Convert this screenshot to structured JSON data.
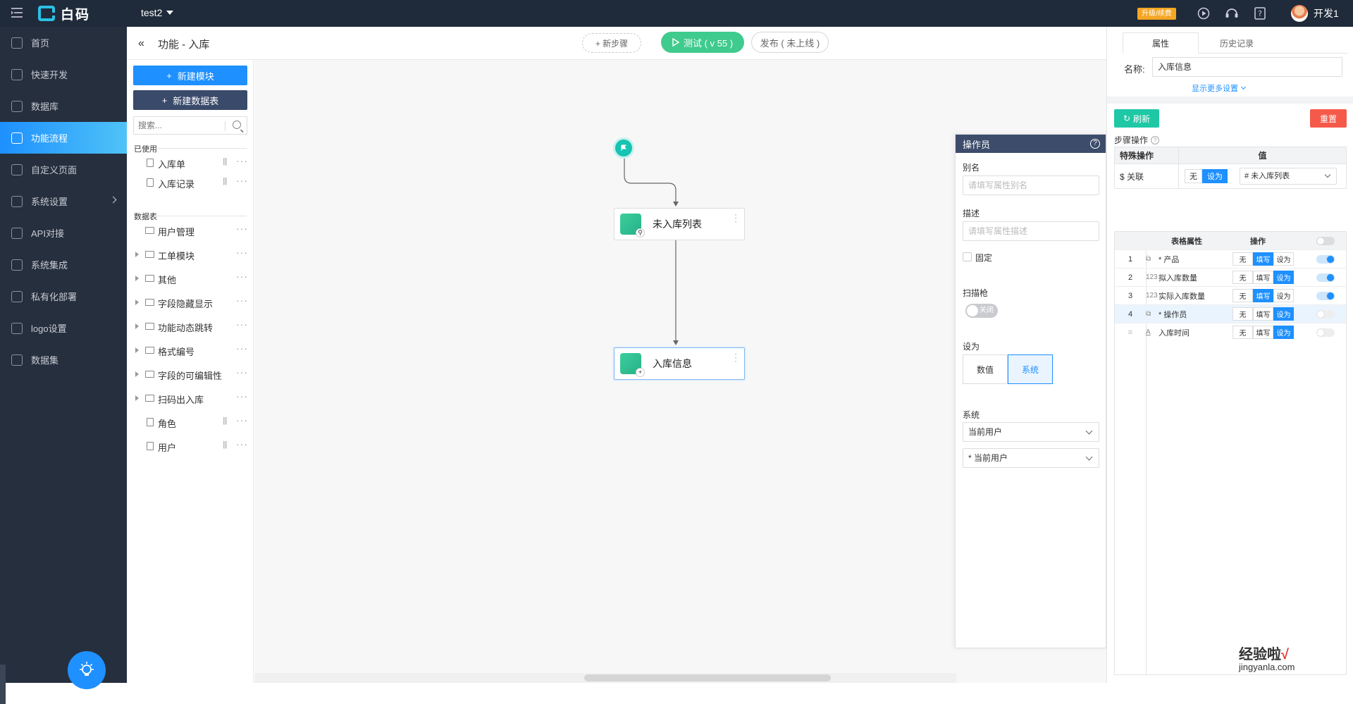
{
  "topbar": {
    "logo_text": "白码",
    "project": "test2",
    "upgrade_label": "升级/续费",
    "user_name": "开发1",
    "icons": [
      "menu-icon",
      "play-circle-icon",
      "support-icon",
      "help-icon"
    ]
  },
  "sidebar": {
    "items": [
      {
        "label": "首页",
        "icon": "home-icon"
      },
      {
        "label": "快速开发",
        "icon": "cube-icon"
      },
      {
        "label": "数据库",
        "icon": "database-icon"
      },
      {
        "label": "功能流程",
        "icon": "flow-icon",
        "active": true
      },
      {
        "label": "自定义页面",
        "icon": "page-icon"
      },
      {
        "label": "系统设置",
        "icon": "settings-icon"
      },
      {
        "label": "API对接",
        "icon": "api-icon"
      },
      {
        "label": "系统集成",
        "icon": "layers-icon"
      },
      {
        "label": "私有化部署",
        "icon": "server-icon"
      },
      {
        "label": "logo设置",
        "icon": "logo-icon"
      },
      {
        "label": "数据集",
        "icon": "dataset-icon"
      }
    ]
  },
  "header": {
    "title": "功能 - 入库",
    "add_step": "+ 新步骤",
    "test_button": "测试 ( v 55 )",
    "publish_button": "发布 ( 未上线 )"
  },
  "tree": {
    "new_module": "新建模块",
    "new_table": "新建数据表",
    "search_placeholder": "搜索...",
    "used_label": "已使用",
    "used_items": [
      "入库单",
      "入库记录"
    ],
    "tables_label": "数据表",
    "table_items": [
      {
        "label": "用户管理",
        "type": "folder",
        "expand": false
      },
      {
        "label": "工单模块",
        "type": "folder",
        "expand": true
      },
      {
        "label": "其他",
        "type": "folder",
        "expand": true
      },
      {
        "label": "字段隐藏显示",
        "type": "folder",
        "expand": true
      },
      {
        "label": "功能动态跳转",
        "type": "folder",
        "expand": true
      },
      {
        "label": "格式编号",
        "type": "folder",
        "expand": true
      },
      {
        "label": "字段的可编辑性",
        "type": "folder",
        "expand": true
      },
      {
        "label": "扫码出入库",
        "type": "folder",
        "expand": true
      },
      {
        "label": "角色",
        "type": "doc",
        "expand": false
      },
      {
        "label": "用户",
        "type": "doc",
        "expand": false
      }
    ]
  },
  "canvas": {
    "node1": "未入库列表",
    "node2": "入库信息"
  },
  "operator_panel": {
    "title": "操作员",
    "alias_label": "别名",
    "alias_placeholder": "请填写属性别名",
    "desc_label": "描述",
    "desc_placeholder": "请填写属性描述",
    "fixed_label": "固定",
    "scanner_label": "扫描枪",
    "scanner_toggle": "关闭",
    "set_label": "设为",
    "seg_value": "数值",
    "seg_system": "系统",
    "system_label": "系统",
    "system_select": "当前用户",
    "system_select2": "* 当前用户"
  },
  "right": {
    "tabs": [
      "属性",
      "历史记录"
    ],
    "name_label": "名称:",
    "name_value": "入库信息",
    "more_settings": "显示更多设置",
    "refresh": "刷新",
    "reset": "重置",
    "step_ops": "步骤操作",
    "sp_head": [
      "特殊操作",
      "值"
    ],
    "sp_row_label": "$ 关联",
    "sp_none": "无",
    "sp_set": "设为",
    "sp_value": "# 未入库列表",
    "ft_head": [
      "表格属性",
      "操作"
    ],
    "op_labels": [
      "无",
      "填写",
      "设为"
    ],
    "fields": [
      {
        "num": "1",
        "icon": "⧉",
        "name": "* 产品",
        "sel": 1,
        "switch": "on"
      },
      {
        "num": "2",
        "icon": "123",
        "name": "拟入库数量",
        "sel": 2,
        "switch": "on"
      },
      {
        "num": "3",
        "icon": "123",
        "name": "实际入库数量",
        "sel": 1,
        "switch": "on"
      },
      {
        "num": "4",
        "icon": "⧉",
        "name": "* 操作员",
        "sel": 2,
        "switch": "off"
      },
      {
        "num": "≡",
        "icon": "A",
        "name": "入库时间",
        "sel": 2,
        "switch": "off"
      }
    ]
  },
  "watermark": {
    "text": "经验啦",
    "check": "√",
    "url": "jingyanla.com"
  }
}
